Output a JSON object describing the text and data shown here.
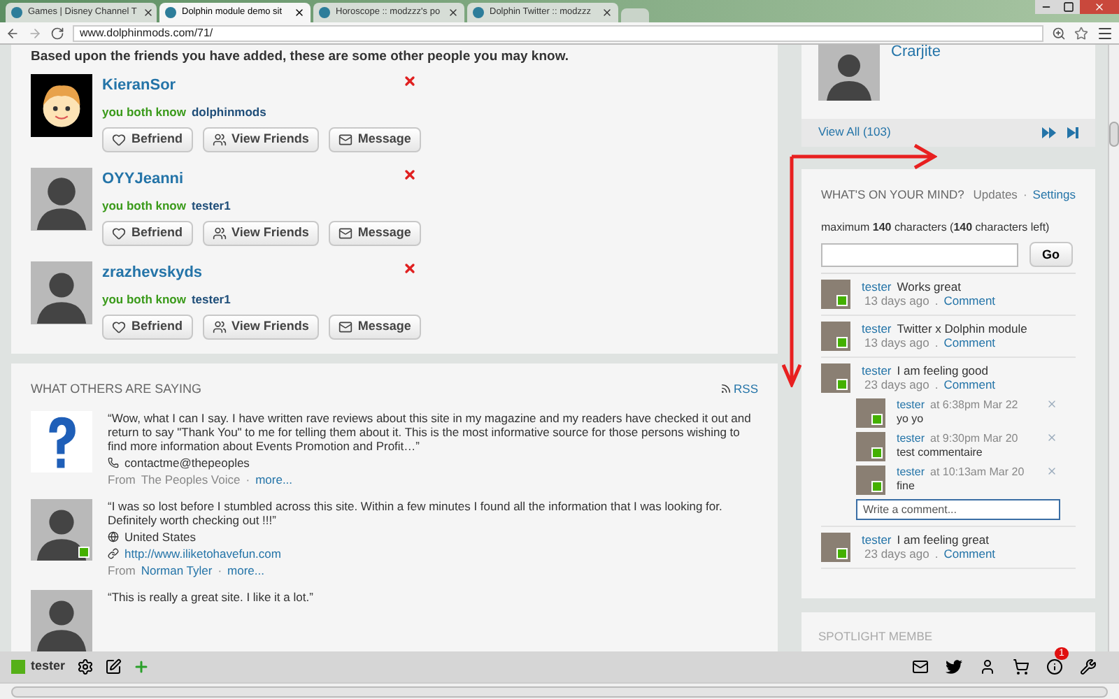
{
  "browser": {
    "tabs": [
      {
        "title": "Games | Disney Channel T",
        "selected": false
      },
      {
        "title": "Dolphin module demo sit",
        "selected": true
      },
      {
        "title": "Horoscope :: modzzz's po",
        "selected": false
      },
      {
        "title": "Dolphin Twitter :: modzzz",
        "selected": false
      }
    ],
    "url": "www.dolphinmods.com/71/"
  },
  "suggestions": {
    "intro": "Based upon the friends you have added, these are some other people you may know.",
    "people": [
      {
        "name": "KieranSor",
        "avatar": {
          "kind": "cartoon"
        },
        "mutual_label": "you both know",
        "mutual": "dolphinmods",
        "buttons": [
          "Befriend",
          "View Friends",
          "Message"
        ]
      },
      {
        "name": "OYYJeanni",
        "avatar": {
          "kind": "silhouette-female"
        },
        "mutual_label": "you both know",
        "mutual": "tester1",
        "buttons": [
          "Befriend",
          "View Friends",
          "Message"
        ]
      },
      {
        "name": "zrazhevskyds",
        "avatar": {
          "kind": "silhouette"
        },
        "mutual_label": "you both know",
        "mutual": "tester1",
        "buttons": [
          "Befriend",
          "View Friends",
          "Message"
        ]
      }
    ]
  },
  "testimonials": {
    "title": "WHAT OTHERS ARE SAYING",
    "rss": "RSS",
    "items": [
      {
        "avatar": {
          "kind": "question"
        },
        "online": false,
        "quote": "“Wow, what I can I say. I have written rave reviews about this site in my magazine and my readers have checked it out and return to say \"Thank You\" to me for telling them about it. This is the most informative source for those persons wishing to find more information about Events Promotion and Profit…”",
        "details": [
          {
            "kind": "phone",
            "text": "contactme@thepeoples"
          }
        ],
        "from_label": "From",
        "from": "The Peoples Voice",
        "from_link": false,
        "sep": "·",
        "more": "more..."
      },
      {
        "avatar": {
          "kind": "silhouette"
        },
        "online": true,
        "quote": "“I was so lost before I stumbled across this site. Within a few minutes I found all the information that I was looking for. Definitely worth checking out !!!”",
        "details": [
          {
            "kind": "globe",
            "text": "United States"
          },
          {
            "kind": "link",
            "text": "http://www.iliketohavefun.com"
          }
        ],
        "from_label": "From",
        "from": "Norman Tyler",
        "from_link": true,
        "sep": "·",
        "more": "more..."
      },
      {
        "avatar": {
          "kind": "silhouette"
        },
        "online": false,
        "quote": "“This is really a great site. I like it a lot.”"
      }
    ]
  },
  "spotlight_top": {
    "name": "Crarjite",
    "view_all": "View All (103)"
  },
  "mind": {
    "title": "WHAT'S ON YOUR MIND?",
    "links": [
      {
        "label": "Updates",
        "selected": true
      },
      {
        "label": "Settings",
        "selected": false
      }
    ],
    "links_sep": "·",
    "limit": "maximum **140** characters (**140** characters left)",
    "button": "Go",
    "posts": [
      {
        "user": "tester",
        "text": "Works great",
        "time": "13 days ago",
        "sep": ".",
        "action": "Comment"
      },
      {
        "user": "tester",
        "text": "Twitter x Dolphin module",
        "time": "13 days ago",
        "sep": ".",
        "action": "Comment"
      },
      {
        "user": "tester",
        "text": "I am feeling good",
        "time": "23 days ago",
        "sep": ".",
        "action": "Comment",
        "comments": [
          {
            "user": "tester",
            "time": "at 6:38pm Mar 22",
            "text": "yo yo"
          },
          {
            "user": "tester",
            "time": "at 9:30pm Mar 20",
            "text": "test commentaire"
          },
          {
            "user": "tester",
            "time": "at 10:13am Mar 20",
            "text": "fine"
          }
        ],
        "comment_placeholder": "Write a comment..."
      },
      {
        "user": "tester",
        "text": "I am feeling great",
        "time": "23 days ago",
        "sep": ".",
        "action": "Comment"
      }
    ]
  },
  "spotlight": {
    "title": "SPOTLIGHT MEMBE"
  },
  "toolbar": {
    "user": "tester",
    "online": true,
    "badge": "1"
  }
}
